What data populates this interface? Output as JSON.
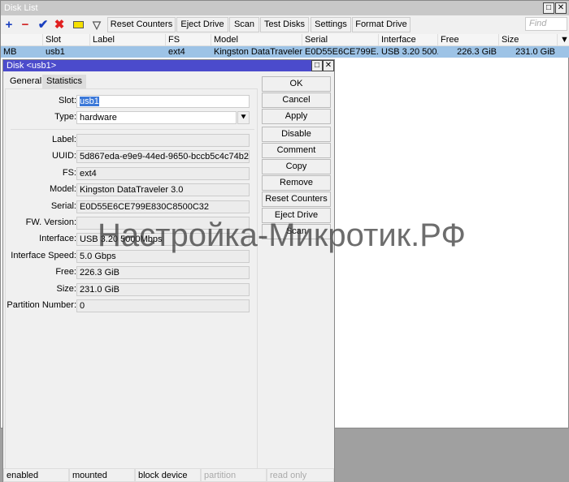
{
  "list": {
    "title": "Disk List",
    "find_placeholder": "Find",
    "toolbar": [
      "Reset Counters",
      "Eject Drive",
      "Scan",
      "Test Disks",
      "Settings",
      "Format Drive"
    ],
    "columns": [
      "",
      "Slot",
      "Label",
      "FS",
      "Model",
      "Serial",
      "Interface",
      "Free",
      "Size"
    ],
    "row": [
      "MB",
      "usb1",
      "",
      "ext4",
      "Kingston DataTraveler...",
      "E0D55E6CE799E...",
      "USB 3.20 500...",
      "226.3 GiB",
      "231.0 GiB"
    ]
  },
  "dialog": {
    "title": "Disk <usb1>",
    "tabs": [
      "General",
      "Statistics"
    ],
    "slot_label": "Slot:",
    "slot": "usb1",
    "type_label": "Type:",
    "type": "hardware",
    "fields": [
      {
        "label": "Label:",
        "value": ""
      },
      {
        "label": "UUID:",
        "value": "5d867eda-e9e9-44ed-9650-bccb5c4c74b2"
      },
      {
        "label": "FS:",
        "value": "ext4"
      },
      {
        "label": "Model:",
        "value": "Kingston DataTraveler 3.0"
      },
      {
        "label": "Serial:",
        "value": "E0D55E6CE799E830C8500C32"
      },
      {
        "label": "FW. Version:",
        "value": ""
      },
      {
        "label": "Interface:",
        "value": "USB 3.20 5000Mbps"
      },
      {
        "label": "Interface Speed:",
        "value": "5.0 Gbps"
      },
      {
        "label": "Free:",
        "value": "226.3 GiB"
      },
      {
        "label": "Size:",
        "value": "231.0 GiB"
      },
      {
        "label": "Partition Number:",
        "value": "0"
      }
    ],
    "buttons": [
      "OK",
      "Cancel",
      "Apply",
      "Disable",
      "Comment",
      "Copy",
      "Remove",
      "Reset Counters",
      "Eject Drive",
      "Scan"
    ],
    "status": [
      "enabled",
      "mounted",
      "block device",
      "partition",
      "read only"
    ]
  },
  "watermark": "Настройка-Микротик.РФ"
}
